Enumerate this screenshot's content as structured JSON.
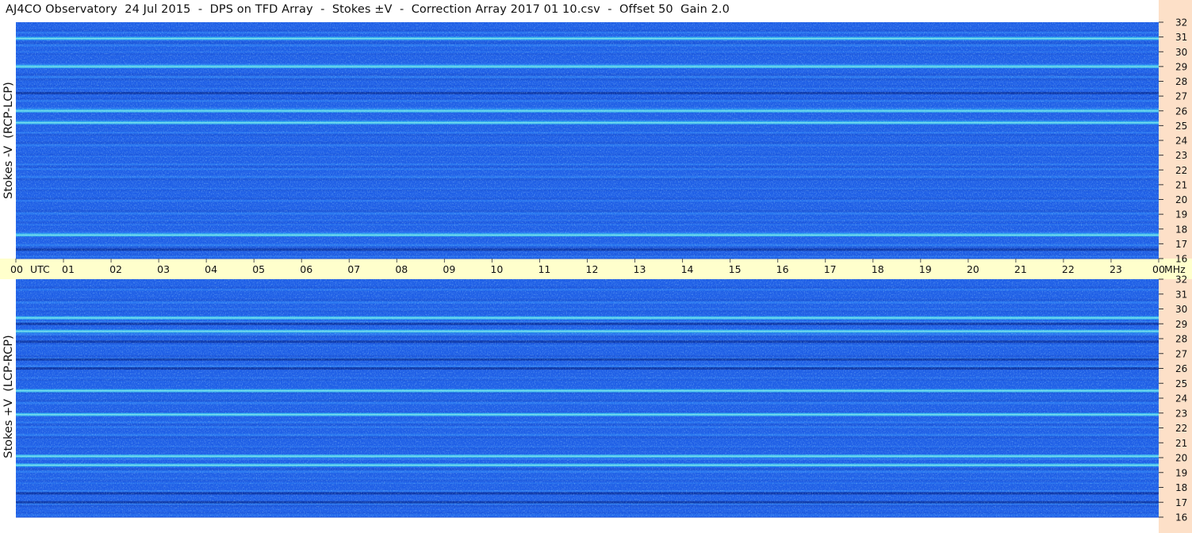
{
  "title": "AJ4CO Observatory  24 Jul 2015  -  DPS on TFD Array  -  Stokes ±V  -  Correction Array 2017 01 10.csv  -  Offset 50  Gain 2.0",
  "colors": {
    "background": "#ffffff",
    "time_strip": "#ffffcc",
    "freq_strip": "#fde0c8",
    "spectrogram_base": "#1f5fe6"
  },
  "chart_data": [
    {
      "type": "heatmap",
      "ylabel": "Stokes -V  (RCP-LCP)",
      "y_ticks": [
        "32",
        "31",
        "30",
        "29",
        "28",
        "27",
        "26",
        "25",
        "24",
        "23",
        "22",
        "21",
        "20",
        "19",
        "18",
        "17",
        "16"
      ],
      "ylim": [
        16,
        32
      ],
      "xlim": [
        0,
        24
      ],
      "bright_bands_mhz": [
        29.0,
        26.0,
        17.6,
        25.2,
        30.9
      ],
      "dark_bands_mhz": [
        27.2,
        16.6
      ]
    },
    {
      "type": "heatmap",
      "ylabel": "Stokes +V  (LCP-RCP)",
      "y_ticks": [
        "32",
        "31",
        "30",
        "29",
        "28",
        "27",
        "26",
        "25",
        "24",
        "23",
        "22",
        "21",
        "20",
        "19",
        "18",
        "17",
        "16"
      ],
      "ylim": [
        16,
        32
      ],
      "xlim": [
        0,
        24
      ],
      "bright_bands_mhz": [
        29.4,
        28.5,
        24.5,
        22.9,
        20.1,
        19.5
      ],
      "dark_bands_mhz": [
        29.0,
        27.8,
        26.6,
        26.0,
        17.6,
        17.0
      ]
    }
  ],
  "time_axis": {
    "labels": [
      "00",
      "UTC",
      "01",
      "02",
      "03",
      "04",
      "05",
      "06",
      "07",
      "08",
      "09",
      "10",
      "11",
      "12",
      "13",
      "14",
      "15",
      "16",
      "17",
      "18",
      "19",
      "20",
      "21",
      "22",
      "23",
      "00",
      "MHz"
    ]
  }
}
